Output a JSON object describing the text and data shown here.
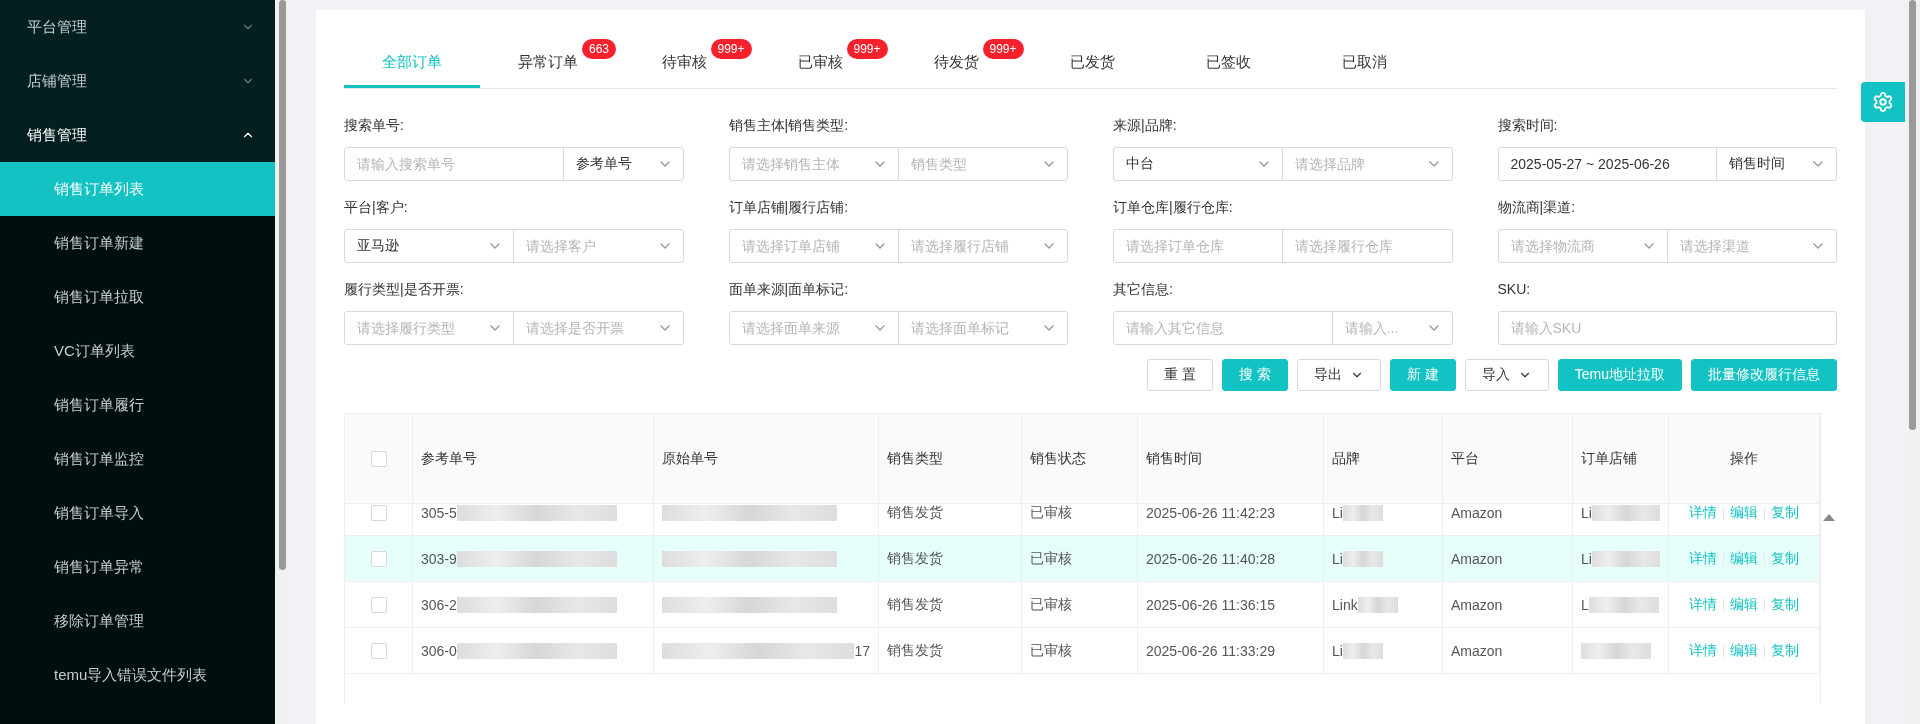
{
  "sidebar": {
    "items": [
      {
        "label": "平台管理",
        "expanded": false
      },
      {
        "label": "店铺管理",
        "expanded": false
      },
      {
        "label": "销售管理",
        "expanded": true,
        "children": [
          {
            "label": "销售订单列表",
            "selected": true
          },
          {
            "label": "销售订单新建",
            "selected": false
          },
          {
            "label": "销售订单拉取",
            "selected": false
          },
          {
            "label": "VC订单列表",
            "selected": false
          },
          {
            "label": "销售订单履行",
            "selected": false
          },
          {
            "label": "销售订单监控",
            "selected": false
          },
          {
            "label": "销售订单导入",
            "selected": false
          },
          {
            "label": "销售订单异常",
            "selected": false
          },
          {
            "label": "移除订单管理",
            "selected": false
          },
          {
            "label": "temu导入错误文件列表",
            "selected": false
          }
        ]
      }
    ]
  },
  "tabs": [
    {
      "label": "全部订单",
      "selected": true
    },
    {
      "label": "异常订单",
      "selected": false,
      "badge": "663"
    },
    {
      "label": "待审核",
      "selected": false,
      "badge": "999+"
    },
    {
      "label": "已审核",
      "selected": false,
      "badge": "999+"
    },
    {
      "label": "待发货",
      "selected": false,
      "badge": "999+"
    },
    {
      "label": "已发货",
      "selected": false
    },
    {
      "label": "已签收",
      "selected": false
    },
    {
      "label": "已取消",
      "selected": false
    }
  ],
  "filters": [
    {
      "label": "搜索单号:",
      "fields": [
        {
          "kind": "input",
          "placeholder": "请输入搜索单号",
          "wide": true
        },
        {
          "kind": "select",
          "value": "参考单号"
        }
      ]
    },
    {
      "label": "销售主体|销售类型:",
      "fields": [
        {
          "kind": "select",
          "placeholder": "请选择销售主体"
        },
        {
          "kind": "select",
          "placeholder": "销售类型"
        }
      ]
    },
    {
      "label": "来源|品牌:",
      "fields": [
        {
          "kind": "select",
          "value": "中台"
        },
        {
          "kind": "select",
          "placeholder": "请选择品牌"
        }
      ]
    },
    {
      "label": "搜索时间:",
      "fields": [
        {
          "kind": "input",
          "value": "2025-05-27 ~ 2025-06-26",
          "wide": true
        },
        {
          "kind": "select",
          "value": "销售时间"
        }
      ]
    },
    {
      "label": "平台|客户:",
      "fields": [
        {
          "kind": "select",
          "value": "亚马逊"
        },
        {
          "kind": "select",
          "placeholder": "请选择客户"
        }
      ]
    },
    {
      "label": "订单店铺|履行店铺:",
      "fields": [
        {
          "kind": "select",
          "placeholder": "请选择订单店铺"
        },
        {
          "kind": "select",
          "placeholder": "请选择履行店铺"
        }
      ]
    },
    {
      "label": "订单仓库|履行仓库:",
      "fields": [
        {
          "kind": "input",
          "placeholder": "请选择订单仓库"
        },
        {
          "kind": "input",
          "placeholder": "请选择履行仓库"
        }
      ]
    },
    {
      "label": "物流商|渠道:",
      "fields": [
        {
          "kind": "select",
          "placeholder": "请选择物流商"
        },
        {
          "kind": "select",
          "placeholder": "请选择渠道"
        }
      ]
    },
    {
      "label": "履行类型|是否开票:",
      "fields": [
        {
          "kind": "select",
          "placeholder": "请选择履行类型"
        },
        {
          "kind": "select",
          "placeholder": "请选择是否开票"
        }
      ]
    },
    {
      "label": "面单来源|面单标记:",
      "fields": [
        {
          "kind": "select",
          "placeholder": "请选择面单来源"
        },
        {
          "kind": "select",
          "placeholder": "请选择面单标记"
        }
      ]
    },
    {
      "label": "其它信息:",
      "fields": [
        {
          "kind": "input",
          "placeholder": "请输入其它信息",
          "wide": true
        },
        {
          "kind": "select",
          "placeholder": "请输入..."
        }
      ]
    },
    {
      "label": "SKU:",
      "fields": [
        {
          "kind": "input",
          "placeholder": "请输入SKU"
        }
      ]
    }
  ],
  "actions": [
    {
      "label": "重 置",
      "kind": "default",
      "dropdown": false
    },
    {
      "label": "搜 索",
      "kind": "primary",
      "dropdown": false
    },
    {
      "label": "导出",
      "kind": "default",
      "dropdown": true
    },
    {
      "label": "新 建",
      "kind": "primary",
      "dropdown": false
    },
    {
      "label": "导入",
      "kind": "default",
      "dropdown": true
    },
    {
      "label": "Temu地址拉取",
      "kind": "primary",
      "dropdown": false
    },
    {
      "label": "批量修改履行信息",
      "kind": "primary",
      "dropdown": false
    }
  ],
  "table": {
    "all_checked": false,
    "columns": [
      "参考单号",
      "原始单号",
      "销售类型",
      "销售状态",
      "销售时间",
      "品牌",
      "平台",
      "订单店铺",
      "操作"
    ],
    "rows": [
      {
        "checked": false,
        "highlighted": false,
        "ref": {
          "text": "305-5",
          "redacted": true
        },
        "orig": {
          "redacted": true
        },
        "type": "销售发货",
        "status": "已审核",
        "time": "2025-06-26 11:42:23",
        "brand": {
          "text": "Li",
          "redacted": true
        },
        "platform": "Amazon",
        "shop": {
          "text": "Li",
          "redacted": true
        },
        "ops": [
          "详情",
          "编辑",
          "复制"
        ]
      },
      {
        "checked": false,
        "highlighted": true,
        "ref": {
          "text": "303-9",
          "redacted": true
        },
        "orig": {
          "redacted": true
        },
        "type": "销售发货",
        "status": "已审核",
        "time": "2025-06-26 11:40:28",
        "brand": {
          "text": "Li",
          "redacted": true
        },
        "platform": "Amazon",
        "shop": {
          "text": "Li",
          "redacted": true
        },
        "ops": [
          "详情",
          "编辑",
          "复制"
        ]
      },
      {
        "checked": false,
        "highlighted": false,
        "ref": {
          "text": "306-2",
          "redacted": true
        },
        "orig": {
          "redacted": true
        },
        "type": "销售发货",
        "status": "已审核",
        "time": "2025-06-26 11:36:15",
        "brand": {
          "text": "Link",
          "redacted": true
        },
        "platform": "Amazon",
        "shop": {
          "text": "L",
          "redacted": true
        },
        "ops": [
          "详情",
          "编辑",
          "复制"
        ]
      },
      {
        "checked": false,
        "highlighted": false,
        "ref": {
          "text": "306-0",
          "redacted": true
        },
        "orig": {
          "text": "17",
          "redacted": true,
          "blur_first": true
        },
        "type": "销售发货",
        "status": "已审核",
        "time": "2025-06-26 11:33:29",
        "brand": {
          "text": "Li",
          "redacted": true
        },
        "platform": "Amazon",
        "shop": {
          "redacted": true
        },
        "ops": [
          "详情",
          "编辑",
          "复制"
        ]
      }
    ]
  }
}
